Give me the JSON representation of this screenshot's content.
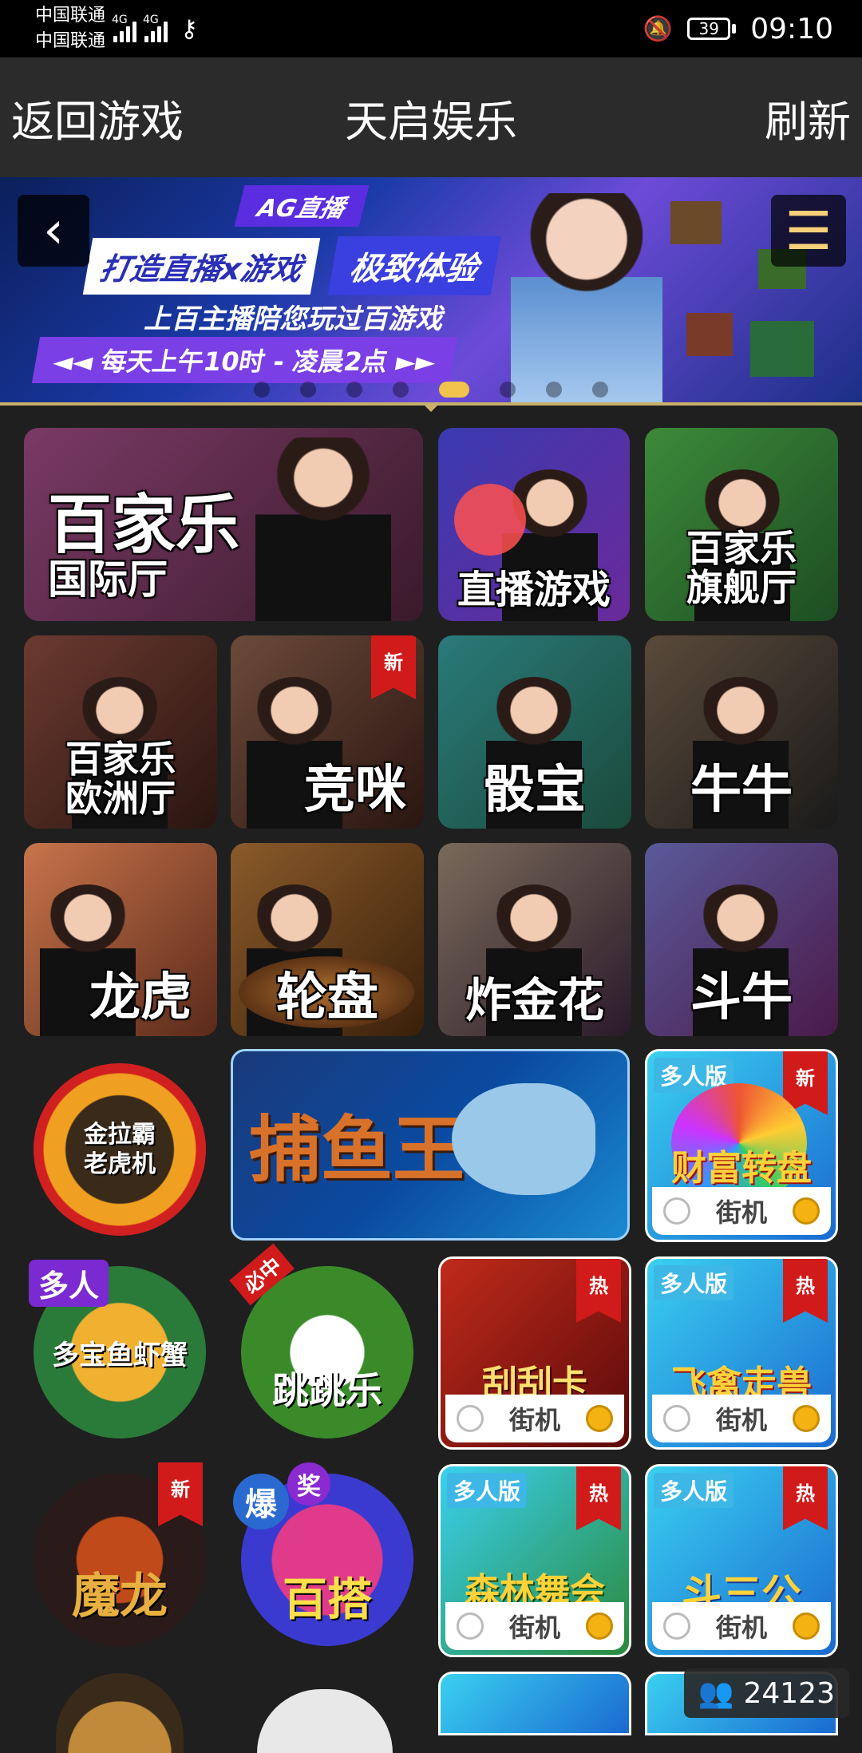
{
  "status_bar": {
    "carrier1": "中国联通",
    "carrier2": "中国联通",
    "network1": "4G",
    "network2": "4G",
    "battery": "39",
    "time": "09:10"
  },
  "header": {
    "back_label": "返回游戏",
    "title": "天启娱乐",
    "refresh_label": "刷新"
  },
  "banner": {
    "tag": "AG直播",
    "headline1": "打造直播x游戏",
    "headline2": "极致体验",
    "subline": "上百主播陪您玩过百游戏",
    "time_line": "◄◄ 每天上午10时 - 凌晨2点 ►►",
    "dot_count": 8,
    "active_dot": 4
  },
  "tiles": [
    {
      "label_top": "百家乐",
      "label_bottom": "国际厅"
    },
    {
      "label_top": "",
      "label_bottom": "直播游戏"
    },
    {
      "label_top": "百家乐",
      "label_bottom": "旗舰厅"
    },
    {
      "label_top": "百家乐",
      "label_bottom": "欧洲厅"
    },
    {
      "label_top": "",
      "label_bottom": "竞咪",
      "badge": "新"
    },
    {
      "label_top": "",
      "label_bottom": "骰宝"
    },
    {
      "label_top": "",
      "label_bottom": "牛牛"
    },
    {
      "label_top": "",
      "label_bottom": "龙虎"
    },
    {
      "label_top": "",
      "label_bottom": "轮盘"
    },
    {
      "label_top": "",
      "label_bottom": "炸金花"
    },
    {
      "label_top": "",
      "label_bottom": "斗牛"
    }
  ],
  "games": {
    "slot": "金拉霸\n老虎机",
    "fish": "捕鱼王",
    "wheel": {
      "title": "财富转盘",
      "tag": "多人版",
      "badge": "新",
      "footer": "街机"
    },
    "crab": {
      "title": "多宝鱼虾蟹",
      "tag": "多人"
    },
    "chicken": {
      "title": "跳跳乐",
      "tag": "必中"
    },
    "scratch": {
      "title": "刮刮卡",
      "badge": "热",
      "footer": "街机"
    },
    "beasts": {
      "title": "飞禽走兽",
      "tag": "多人版",
      "badge": "热",
      "footer": "街机"
    },
    "dragon": {
      "title": "魔龙",
      "badge": "新"
    },
    "baccarat777": {
      "title": "百搭",
      "tag1": "爆",
      "tag2": "奖"
    },
    "forest": {
      "title": "森林舞会",
      "tag": "多人版",
      "badge": "热",
      "footer": "街机"
    },
    "sangong": {
      "title": "斗三公",
      "tag": "多人版",
      "badge": "热",
      "footer": "街机"
    }
  },
  "online_count": "24123",
  "colors": {
    "background": "#1f1f1f",
    "header": "#2b2b2b",
    "badge_red": "#d11b1b",
    "accent_gold": "#f1c24c"
  }
}
